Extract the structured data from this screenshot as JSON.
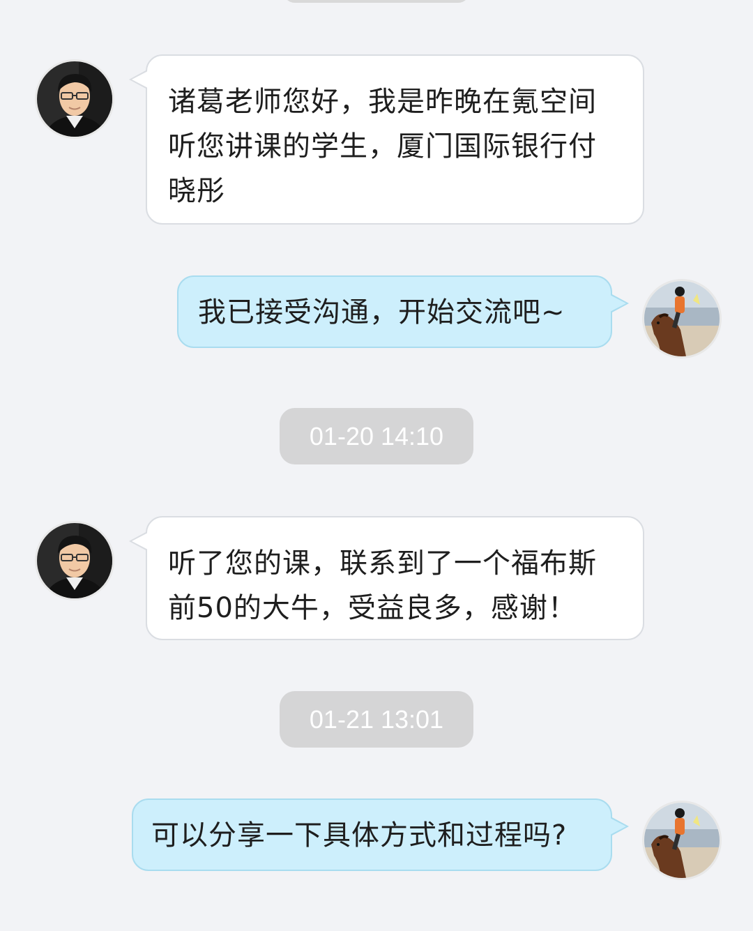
{
  "chat": {
    "messages": [
      {
        "direction": "incoming",
        "avatar": "teacher-avatar",
        "text": "诸葛老师您好，我是昨晚在氪空间听您讲课的学生，厦门国际银行付晓彤"
      },
      {
        "direction": "outgoing",
        "avatar": "rider-avatar",
        "text": "我已接受沟通，开始交流吧~"
      },
      {
        "type": "timestamp",
        "text": "01-20 14:10"
      },
      {
        "direction": "incoming",
        "avatar": "teacher-avatar",
        "text": "听了您的课，联系到了一个福布斯前50的大牛，受益良多，感谢！"
      },
      {
        "type": "timestamp",
        "text": "01-21 13:01"
      },
      {
        "direction": "outgoing",
        "avatar": "rider-avatar",
        "text": "可以分享一下具体方式和过程吗?"
      }
    ]
  },
  "colors": {
    "background": "#f2f3f6",
    "incoming_bubble": "#ffffff",
    "outgoing_bubble": "#cdeffc",
    "timestamp_pill": "#d5d5d6"
  }
}
